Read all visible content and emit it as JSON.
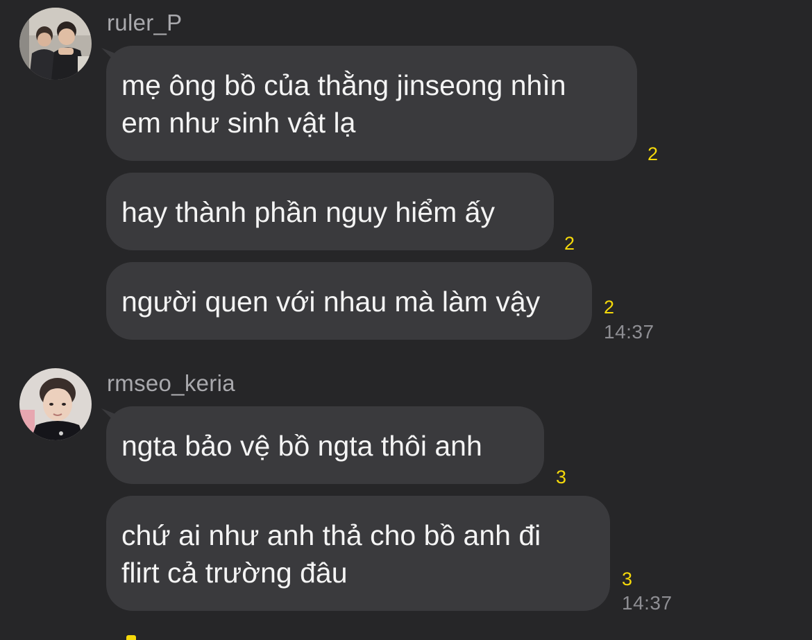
{
  "colors": {
    "background": "#262628",
    "bubble": "#3a3a3d",
    "unread": "#f5d90a",
    "meta_text": "#8e8e93"
  },
  "groups": [
    {
      "sender": "ruler_P",
      "avatar_icon": "user-avatar-photo",
      "messages": [
        {
          "lines": [
            "mẹ ông bồ của thằng jinseong nhìn",
            "em như sinh vật lạ"
          ],
          "unread": "2"
        },
        {
          "lines": [
            "hay thành phần nguy hiểm ấy"
          ],
          "unread": "2"
        },
        {
          "lines": [
            "người quen với nhau mà làm vậy"
          ],
          "unread": "2",
          "time": "14:37"
        }
      ]
    },
    {
      "sender": "rmseo_keria",
      "avatar_icon": "user-avatar-photo",
      "messages": [
        {
          "lines": [
            "ngta bảo vệ bồ ngta thôi anh"
          ],
          "unread": "3"
        },
        {
          "lines": [
            "chứ ai như anh thả cho bồ anh đi",
            "flirt cả trường đâu"
          ],
          "unread": "3",
          "time": "14:37"
        }
      ]
    }
  ]
}
